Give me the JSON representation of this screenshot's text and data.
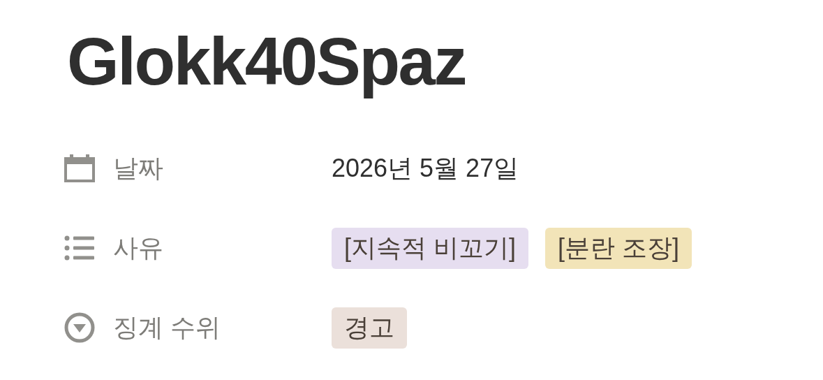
{
  "title": "Glokk40Spaz",
  "properties": [
    {
      "kind": "date",
      "label": "날짜",
      "value": "2026년 5월 27일"
    },
    {
      "kind": "multi_select",
      "label": "사유",
      "tags": [
        {
          "text": "[지속적 비꼬기]",
          "color": "#e6def0"
        },
        {
          "text": "[분란 조장]",
          "color": "#f2e4b8"
        }
      ]
    },
    {
      "kind": "select",
      "label": "징계 수위",
      "tags": [
        {
          "text": "경고",
          "color": "#ebe0da"
        }
      ]
    }
  ]
}
